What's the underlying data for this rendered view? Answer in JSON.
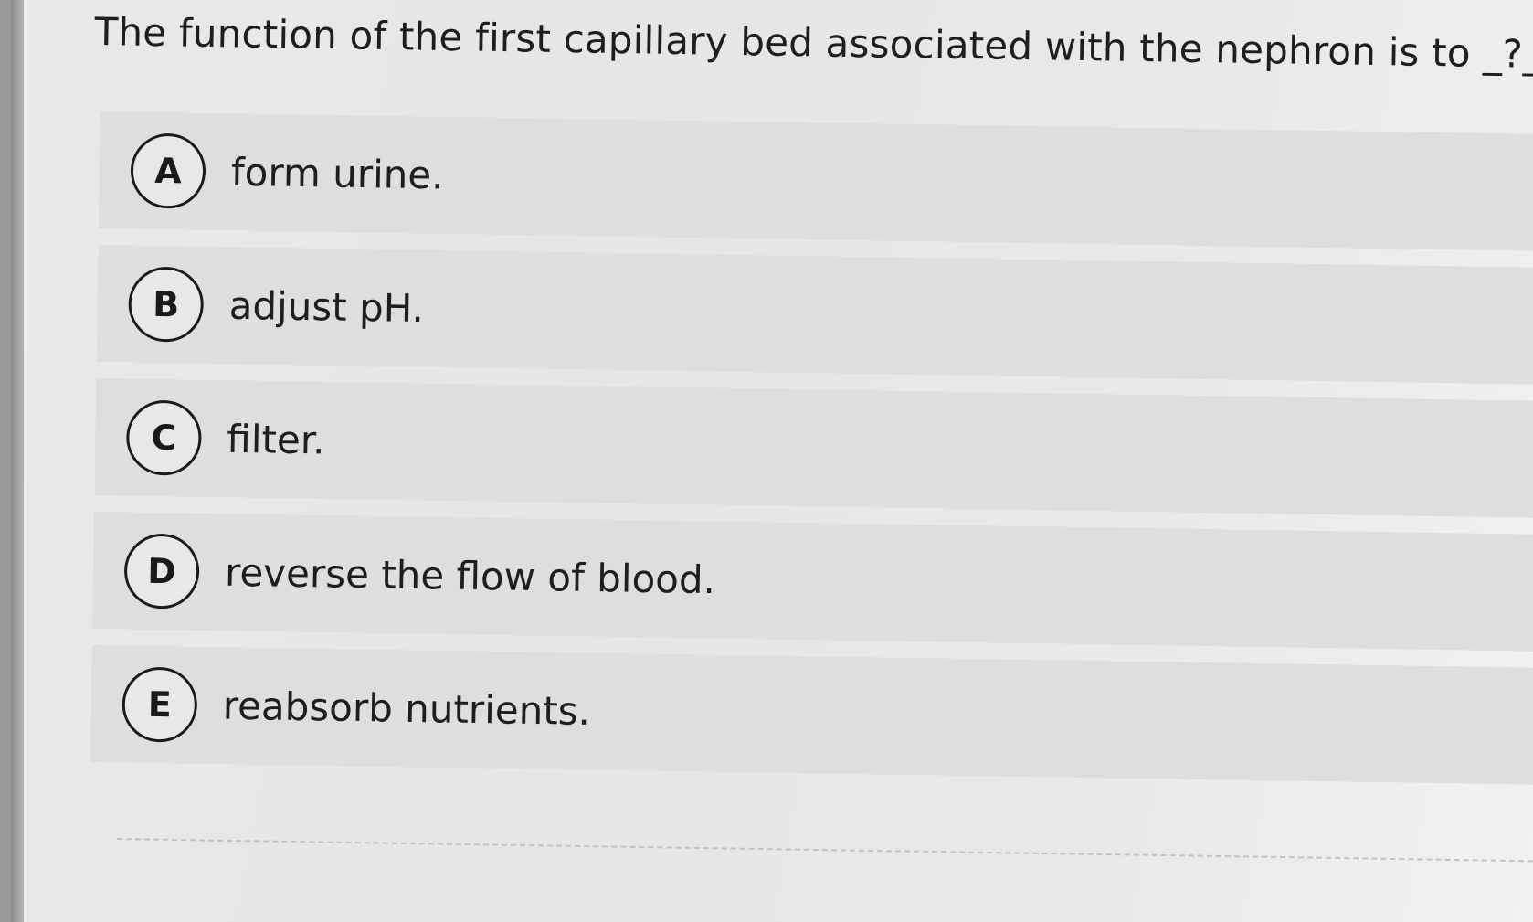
{
  "question": {
    "text": "The function of the first capillary bed associated with the nephron is to _?_"
  },
  "options": [
    {
      "letter": "A",
      "text": "form urine."
    },
    {
      "letter": "B",
      "text": "adjust pH."
    },
    {
      "letter": "C",
      "text": "filter."
    },
    {
      "letter": "D",
      "text": "reverse the flow of blood."
    },
    {
      "letter": "E",
      "text": "reabsorb nutrients."
    }
  ]
}
